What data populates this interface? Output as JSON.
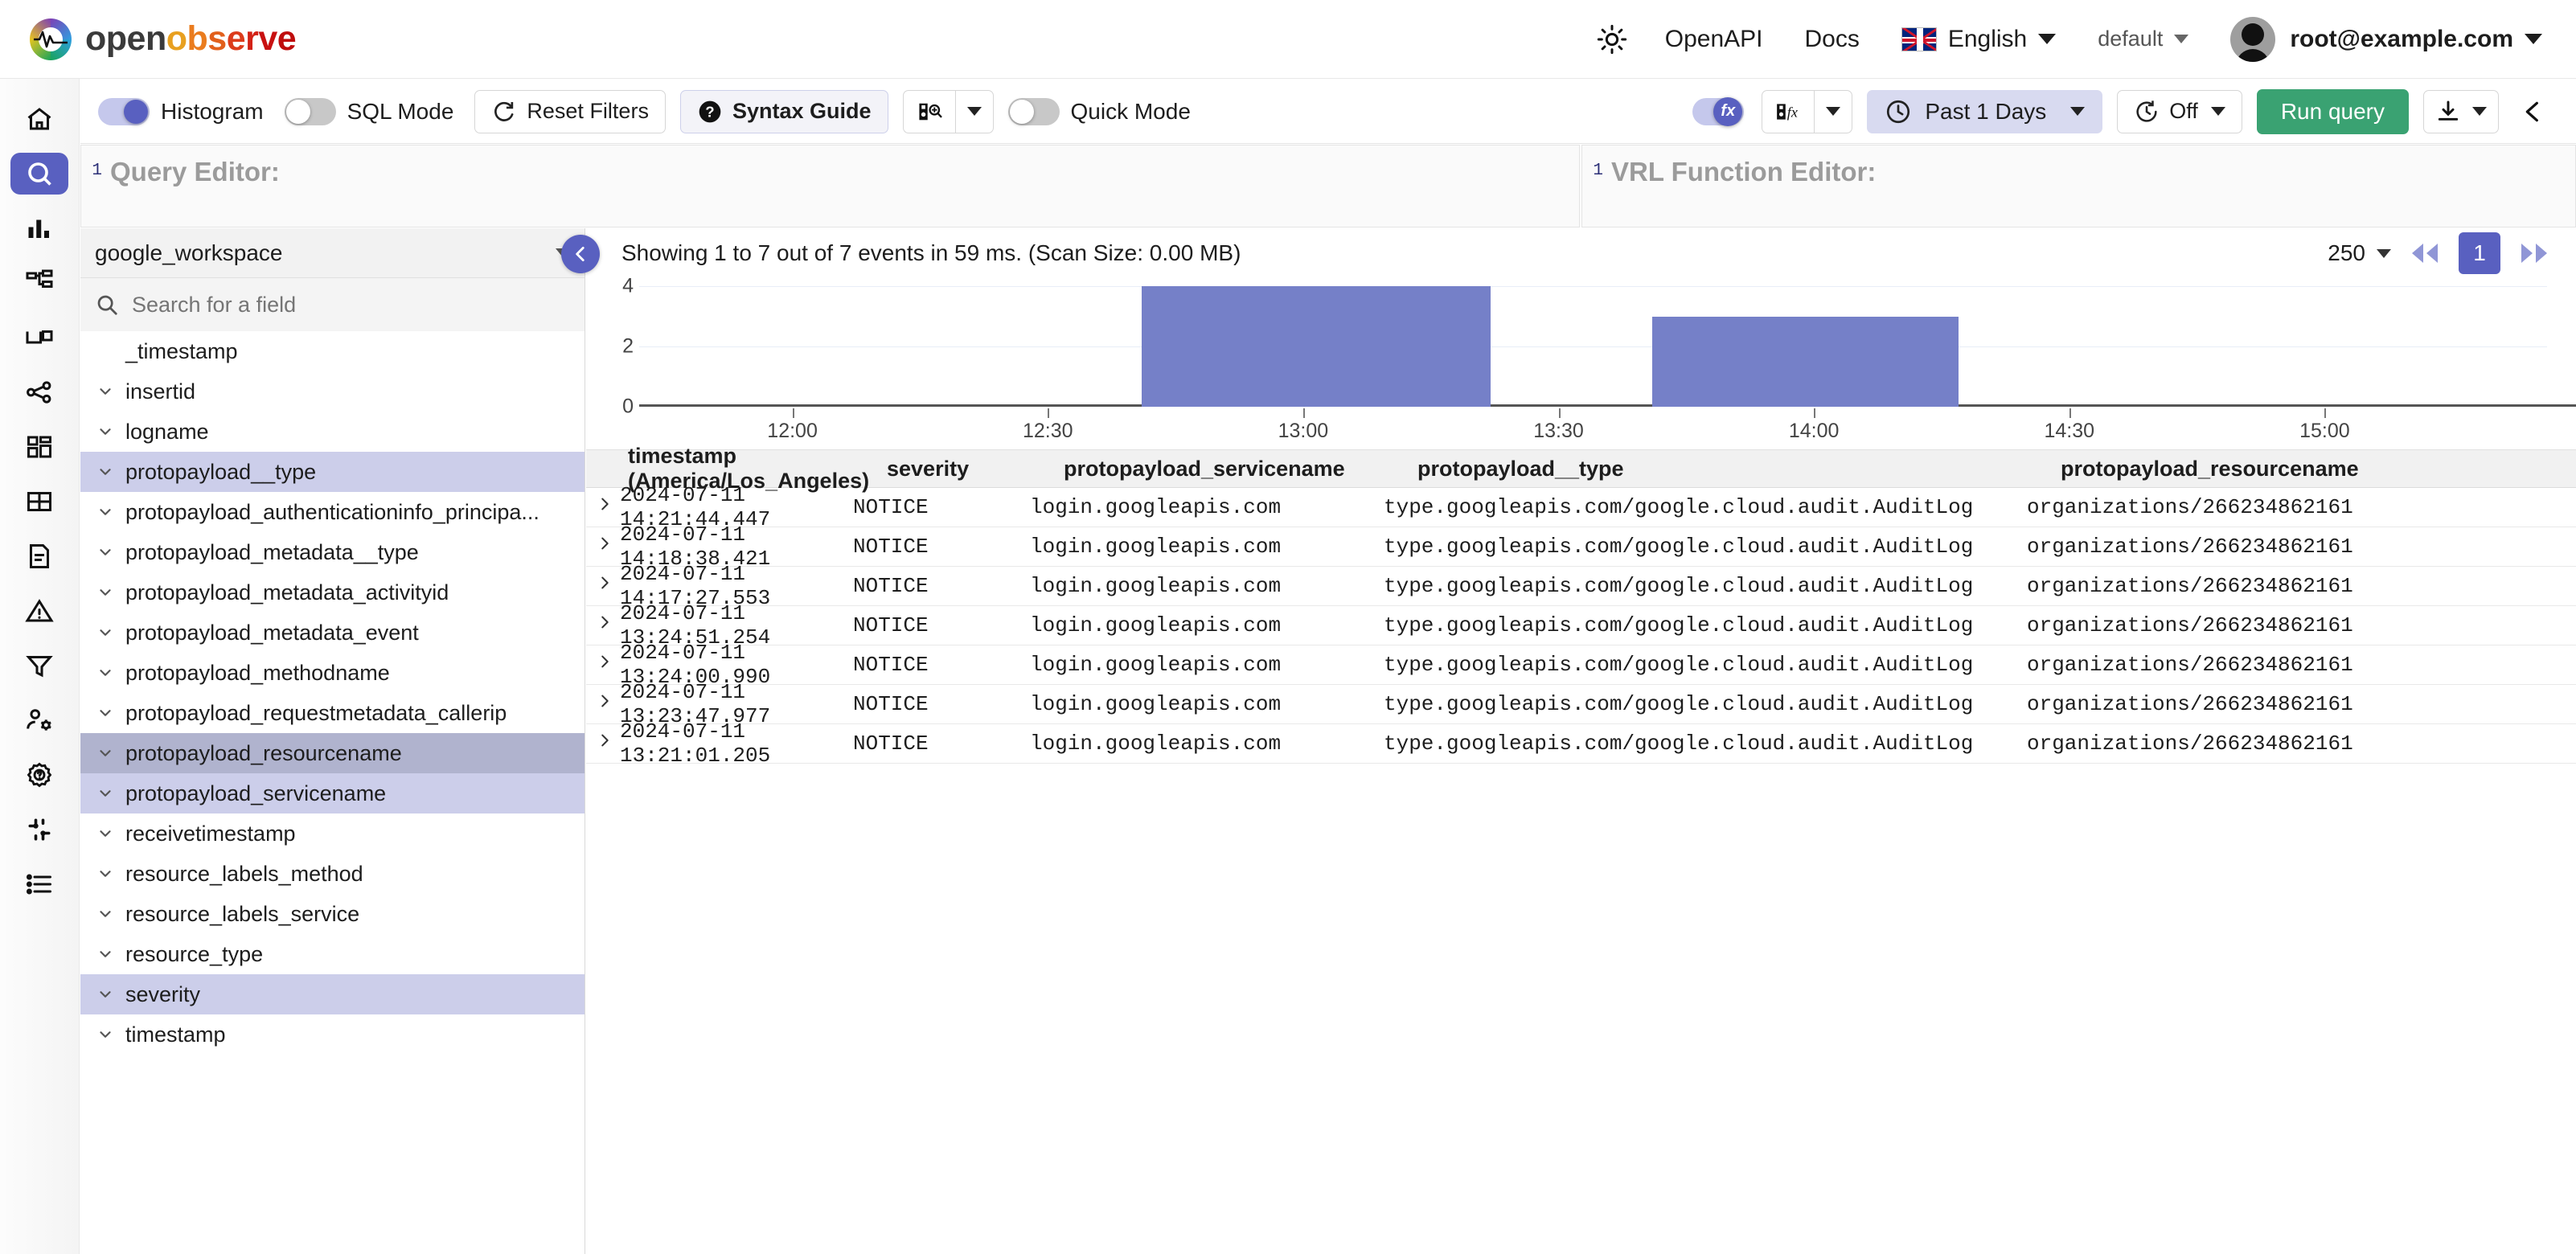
{
  "brand": {
    "name_part1": "open",
    "name_letters": [
      "o",
      "b",
      "s",
      "e",
      "r",
      "v",
      "e"
    ]
  },
  "header": {
    "theme_toggle_icon": "sun-icon",
    "openapi": "OpenAPI",
    "docs": "Docs",
    "language": "English",
    "organization": "default",
    "user_email": "root@example.com"
  },
  "rail": {
    "items": [
      {
        "name": "home",
        "icon": "home-icon",
        "active": false
      },
      {
        "name": "logs-search",
        "icon": "search-icon",
        "active": true
      },
      {
        "name": "metrics",
        "icon": "bar-chart-icon",
        "active": false
      },
      {
        "name": "pipelines",
        "icon": "pipeline-icon",
        "active": false
      },
      {
        "name": "streams",
        "icon": "stream-icon",
        "active": false
      },
      {
        "name": "traces",
        "icon": "share-nodes-icon",
        "active": false
      },
      {
        "name": "dashboards",
        "icon": "dashboard-grid-icon",
        "active": false
      },
      {
        "name": "tables",
        "icon": "table-icon",
        "active": false
      },
      {
        "name": "reports",
        "icon": "document-icon",
        "active": false
      },
      {
        "name": "alerts",
        "icon": "warning-triangle-icon",
        "active": false
      },
      {
        "name": "functions",
        "icon": "funnel-icon",
        "active": false
      },
      {
        "name": "iam-users",
        "icon": "user-settings-icon",
        "active": false
      },
      {
        "name": "management",
        "icon": "gear-help-icon",
        "active": false
      },
      {
        "name": "slack",
        "icon": "slack-icon",
        "active": false
      },
      {
        "name": "about",
        "icon": "list-icon",
        "active": false
      }
    ]
  },
  "toolbar": {
    "histogram_label": "Histogram",
    "histogram_on": true,
    "sql_mode_label": "SQL Mode",
    "sql_mode_on": false,
    "reset_filters_label": "Reset Filters",
    "syntax_guide_label": "Syntax Guide",
    "saved_views_icon": "save-search-icon",
    "saved_views_caret": "chevron-down-icon",
    "quick_mode_label": "Quick Mode",
    "quick_mode_on": false,
    "vrl_toggle_on": true,
    "fx_label": "fx",
    "fx_caret": "chevron-down-icon",
    "time_range": "Past 1 Days",
    "refresh_interval": "Off",
    "run_query_label": "Run query",
    "download_icon": "download-icon",
    "share_icon": "share-icon"
  },
  "editors": {
    "query": {
      "line_number": "1",
      "placeholder": "Query Editor:"
    },
    "vrl": {
      "line_number": "1",
      "placeholder": "VRL Function Editor:"
    }
  },
  "sidebar": {
    "stream": "google_workspace",
    "search_placeholder": "Search for a field",
    "fields": [
      {
        "label": "_timestamp",
        "expandable": false,
        "state": "none"
      },
      {
        "label": "insertid",
        "expandable": true,
        "state": "none"
      },
      {
        "label": "logname",
        "expandable": true,
        "state": "none"
      },
      {
        "label": "protopayload__type",
        "expandable": true,
        "state": "selected"
      },
      {
        "label": "protopayload_authenticationinfo_principa...",
        "expandable": true,
        "state": "none"
      },
      {
        "label": "protopayload_metadata__type",
        "expandable": true,
        "state": "none"
      },
      {
        "label": "protopayload_metadata_activityid",
        "expandable": true,
        "state": "none"
      },
      {
        "label": "protopayload_metadata_event",
        "expandable": true,
        "state": "none"
      },
      {
        "label": "protopayload_methodname",
        "expandable": true,
        "state": "none"
      },
      {
        "label": "protopayload_requestmetadata_callerip",
        "expandable": true,
        "state": "none"
      },
      {
        "label": "protopayload_resourcename",
        "expandable": true,
        "state": "hover"
      },
      {
        "label": "protopayload_servicename",
        "expandable": true,
        "state": "selected"
      },
      {
        "label": "receivetimestamp",
        "expandable": true,
        "state": "none"
      },
      {
        "label": "resource_labels_method",
        "expandable": true,
        "state": "none"
      },
      {
        "label": "resource_labels_service",
        "expandable": true,
        "state": "none"
      },
      {
        "label": "resource_type",
        "expandable": true,
        "state": "none"
      },
      {
        "label": "severity",
        "expandable": true,
        "state": "selected"
      },
      {
        "label": "timestamp",
        "expandable": true,
        "state": "none"
      }
    ]
  },
  "results": {
    "summary": "Showing 1 to 7 out of 7 events in 59 ms. (Scan Size: 0.00 MB)",
    "page_size": "250",
    "current_page": "1",
    "collapse_icon": "chevron-left-icon",
    "first_page_icon": "double-chevron-left-icon",
    "last_page_icon": "double-chevron-right-icon"
  },
  "chart_data": {
    "type": "bar",
    "title": "",
    "xlabel": "",
    "ylabel": "",
    "ylim": [
      0,
      4
    ],
    "yticks": [
      0,
      2,
      4
    ],
    "xticks": [
      "12:00",
      "12:30",
      "13:00",
      "13:30",
      "14:00",
      "14:30",
      "15:00"
    ],
    "xtick_minutes": [
      720,
      750,
      780,
      810,
      840,
      870,
      900
    ],
    "grid": true,
    "bar_color": "#7580c8",
    "bars": [
      {
        "start": "12:41",
        "end": "13:22",
        "start_min": 761,
        "end_min": 802,
        "value": 4
      },
      {
        "start": "13:41",
        "end": "14:17",
        "start_min": 821,
        "end_min": 857,
        "value": 3
      }
    ]
  },
  "table": {
    "columns": [
      {
        "key": "timestamp",
        "label": "timestamp (America/Los_Angeles)"
      },
      {
        "key": "severity",
        "label": "severity"
      },
      {
        "key": "servicename",
        "label": "protopayload_servicename"
      },
      {
        "key": "type",
        "label": "protopayload__type"
      },
      {
        "key": "resourcename",
        "label": "protopayload_resourcename"
      }
    ],
    "expand_icon": "chevron-right-icon",
    "rows": [
      {
        "timestamp": "2024-07-11 14:21:44.447",
        "severity": "NOTICE",
        "servicename": "login.googleapis.com",
        "type": "type.googleapis.com/google.cloud.audit.AuditLog",
        "resourcename": "organizations/266234862161"
      },
      {
        "timestamp": "2024-07-11 14:18:38.421",
        "severity": "NOTICE",
        "servicename": "login.googleapis.com",
        "type": "type.googleapis.com/google.cloud.audit.AuditLog",
        "resourcename": "organizations/266234862161"
      },
      {
        "timestamp": "2024-07-11 14:17:27.553",
        "severity": "NOTICE",
        "servicename": "login.googleapis.com",
        "type": "type.googleapis.com/google.cloud.audit.AuditLog",
        "resourcename": "organizations/266234862161"
      },
      {
        "timestamp": "2024-07-11 13:24:51.254",
        "severity": "NOTICE",
        "servicename": "login.googleapis.com",
        "type": "type.googleapis.com/google.cloud.audit.AuditLog",
        "resourcename": "organizations/266234862161"
      },
      {
        "timestamp": "2024-07-11 13:24:00.990",
        "severity": "NOTICE",
        "servicename": "login.googleapis.com",
        "type": "type.googleapis.com/google.cloud.audit.AuditLog",
        "resourcename": "organizations/266234862161"
      },
      {
        "timestamp": "2024-07-11 13:23:47.977",
        "severity": "NOTICE",
        "servicename": "login.googleapis.com",
        "type": "type.googleapis.com/google.cloud.audit.AuditLog",
        "resourcename": "organizations/266234862161"
      },
      {
        "timestamp": "2024-07-11 13:21:01.205",
        "severity": "NOTICE",
        "servicename": "login.googleapis.com",
        "type": "type.googleapis.com/google.cloud.audit.AuditLog",
        "resourcename": "organizations/266234862161"
      }
    ]
  }
}
